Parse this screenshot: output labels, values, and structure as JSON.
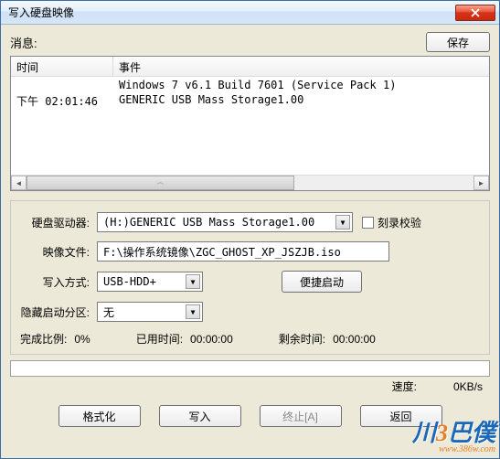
{
  "window": {
    "title": "写入硬盘映像"
  },
  "toolbar": {
    "msg_label": "消息:",
    "save_label": "保存"
  },
  "log": {
    "header_time": "时间",
    "header_event": "事件",
    "rows": [
      {
        "time": "",
        "event": "Windows 7 v6.1 Build 7601 (Service Pack 1)"
      },
      {
        "time": "下午 02:01:46",
        "event": "GENERIC USB Mass Storage1.00"
      }
    ]
  },
  "form": {
    "drive_label": "硬盘驱动器:",
    "drive_value": "(H:)GENERIC USB Mass Storage1.00",
    "verify_label": "刻录校验",
    "image_label": "映像文件:",
    "image_value": "F:\\操作系统镜像\\ZGC_GHOST_XP_JSZJB.iso",
    "method_label": "写入方式:",
    "method_value": "USB-HDD+",
    "quick_btn": "便捷启动",
    "hide_label": "隐藏启动分区:",
    "hide_value": "无"
  },
  "stats": {
    "done_label": "完成比例:",
    "done_value": "0%",
    "elapsed_label": "已用时间:",
    "elapsed_value": "00:00:00",
    "remain_label": "剩余时间:",
    "remain_value": "00:00:00",
    "speed_label": "速度:",
    "speed_value": "0KB/s"
  },
  "buttons": {
    "format": "格式化",
    "write": "写入",
    "abort": "终止[A]",
    "back": "返回"
  },
  "watermark": {
    "prefix": "川",
    "num": "3",
    "suffix": "巴僕",
    "url": "www.386w.com"
  }
}
